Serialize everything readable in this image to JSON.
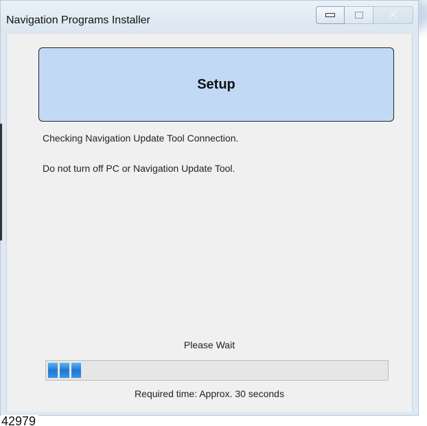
{
  "window": {
    "title": "Navigation Programs Installer",
    "controls": {
      "minimize_icon": "minimize-icon",
      "maximize_icon": "maximize-icon",
      "close_icon": "close-icon",
      "close_glyph": "✕"
    }
  },
  "banner": {
    "title": "Setup",
    "background": "#c2d9f6"
  },
  "messages": [
    "Checking Navigation Update Tool Connection.",
    "Do not turn off PC or Navigation Update Tool."
  ],
  "progress": {
    "label": "Please Wait",
    "segments_filled": 3,
    "fraction": 0.06,
    "color": "#1e78d2",
    "time_text": "Required time: Approx. 30 seconds"
  },
  "figure_id": "42979"
}
